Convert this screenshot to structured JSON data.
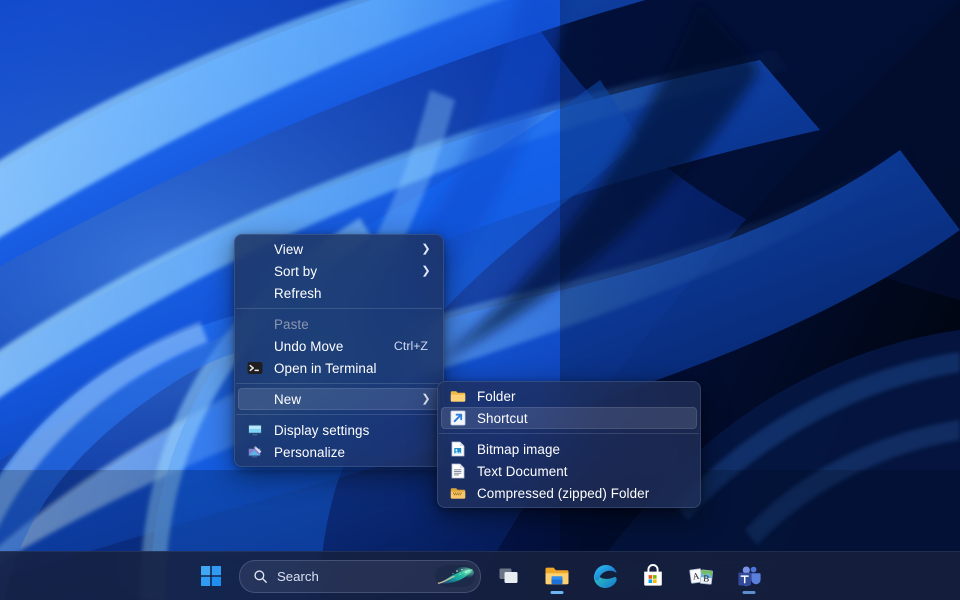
{
  "desktop": {
    "wallpaper_name": "windows-11-bloom-abstract",
    "colors": {
      "accent_blue": "#1763ef",
      "deep_navy": "#020a24",
      "ribbon_highlight": "#7cc8ff",
      "menu_bg": "#203056",
      "taskbar_bg": "#17213c",
      "selection": "#ffffff1d"
    }
  },
  "context_menu": {
    "name": "desktop-context-menu",
    "items": [
      {
        "id": "view",
        "label": "View",
        "icon": "",
        "accel": "",
        "submenu": true,
        "disabled": false,
        "selected": false
      },
      {
        "id": "sort-by",
        "label": "Sort by",
        "icon": "",
        "accel": "",
        "submenu": true,
        "disabled": false,
        "selected": false
      },
      {
        "id": "refresh",
        "label": "Refresh",
        "icon": "",
        "accel": "",
        "submenu": false,
        "disabled": false,
        "selected": false
      },
      {
        "id": "separator-1",
        "label": "",
        "icon": "",
        "accel": "",
        "submenu": false,
        "disabled": false,
        "selected": false
      },
      {
        "id": "paste",
        "label": "Paste",
        "icon": "",
        "accel": "",
        "submenu": false,
        "disabled": true,
        "selected": false
      },
      {
        "id": "undo-move",
        "label": "Undo Move",
        "icon": "",
        "accel": "Ctrl+Z",
        "submenu": false,
        "disabled": false,
        "selected": false
      },
      {
        "id": "open-in-terminal",
        "label": "Open in Terminal",
        "icon": "terminal-icon",
        "accel": "",
        "submenu": false,
        "disabled": false,
        "selected": false
      },
      {
        "id": "separator-2",
        "label": "",
        "icon": "",
        "accel": "",
        "submenu": false,
        "disabled": false,
        "selected": false
      },
      {
        "id": "new",
        "label": "New",
        "icon": "",
        "accel": "",
        "submenu": true,
        "disabled": false,
        "selected": true
      },
      {
        "id": "separator-3",
        "label": "",
        "icon": "",
        "accel": "",
        "submenu": false,
        "disabled": false,
        "selected": false
      },
      {
        "id": "display-settings",
        "label": "Display settings",
        "icon": "monitor-icon",
        "accel": "",
        "submenu": false,
        "disabled": false,
        "selected": false
      },
      {
        "id": "personalize",
        "label": "Personalize",
        "icon": "personalize-icon",
        "accel": "",
        "submenu": false,
        "disabled": false,
        "selected": false
      }
    ]
  },
  "new_submenu": {
    "name": "new-submenu",
    "items": [
      {
        "id": "folder",
        "label": "Folder",
        "icon": "folder-icon",
        "selected": false
      },
      {
        "id": "shortcut",
        "label": "Shortcut",
        "icon": "shortcut-icon",
        "selected": true
      },
      {
        "id": "separator-1",
        "label": "",
        "icon": "",
        "selected": false
      },
      {
        "id": "bitmap-image",
        "label": "Bitmap image",
        "icon": "bitmap-image-icon",
        "selected": false
      },
      {
        "id": "text-document",
        "label": "Text Document",
        "icon": "text-document-icon",
        "selected": false
      },
      {
        "id": "compressed-folder",
        "label": "Compressed (zipped) Folder",
        "icon": "zip-folder-icon",
        "selected": false
      }
    ]
  },
  "taskbar": {
    "start_button": {
      "label": "Start",
      "icon": "windows-logo-icon"
    },
    "search": {
      "placeholder": "Search",
      "value": "Search",
      "icon": "search-icon",
      "trailing_icon": "copilot-icon"
    },
    "buttons": [
      {
        "id": "task-view",
        "label": "Task view",
        "icon": "task-view-icon",
        "running": false
      },
      {
        "id": "file-explorer",
        "label": "File Explorer",
        "icon": "file-explorer-icon",
        "running": true
      },
      {
        "id": "microsoft-edge",
        "label": "Microsoft Edge",
        "icon": "edge-icon",
        "running": false
      },
      {
        "id": "microsoft-store",
        "label": "Microsoft Store",
        "icon": "store-icon",
        "running": false
      },
      {
        "id": "translator",
        "label": "Translator",
        "icon": "translator-icon",
        "running": false
      },
      {
        "id": "teams",
        "label": "Microsoft Teams",
        "icon": "teams-icon",
        "running": true
      }
    ]
  }
}
